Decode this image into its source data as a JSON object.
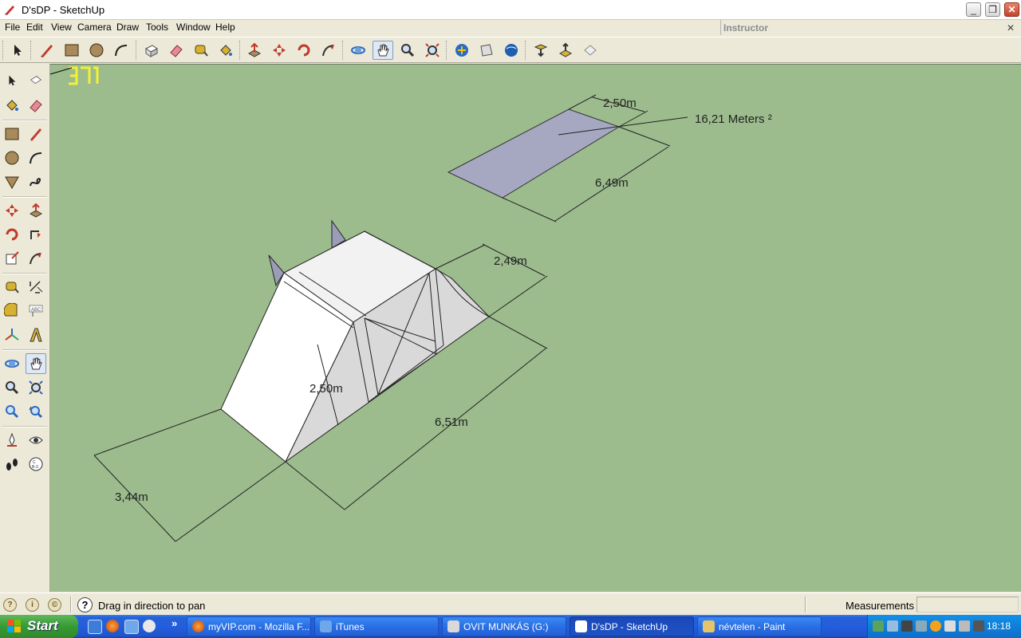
{
  "window": {
    "title": "D'sDP - SketchUp"
  },
  "menubar": {
    "items": [
      "File",
      "Edit",
      "View",
      "Camera",
      "Draw",
      "Tools",
      "Window",
      "Help"
    ]
  },
  "instructor": {
    "label": "Instructor"
  },
  "toolbar": {
    "icons": [
      "select-icon",
      "pencil-icon",
      "rectangle-icon",
      "circle-icon",
      "arc-icon",
      "make-component-icon",
      "eraser-icon",
      "tape-measure-icon",
      "paint-bucket-icon",
      "push-pull-icon",
      "move-icon",
      "rotate-icon",
      "follow-me-icon",
      "orbit-icon",
      "pan-icon",
      "zoom-icon",
      "zoom-extents-icon",
      "get-models-icon",
      "share-model-icon",
      "google-earth-icon",
      "get-current-view-icon",
      "toggle-terrain-icon",
      "place-model-icon"
    ]
  },
  "leftbar": {
    "icons": [
      "select-icon",
      "make-component-icon",
      "paint-bucket-icon",
      "eraser-icon",
      "rectangle-icon",
      "pencil-icon",
      "circle-icon",
      "arc-icon",
      "polygon-icon",
      "freehand-icon",
      "move-icon",
      "push-pull-icon",
      "rotate-icon",
      "follow-me-icon",
      "scale-icon",
      "offset-icon",
      "tape-measure-icon",
      "dimension-icon",
      "protractor-icon",
      "text-icon",
      "axes-icon",
      "3d-text-icon",
      "orbit-icon",
      "pan-icon",
      "zoom-icon",
      "zoom-window-icon",
      "zoom-extents-icon",
      "previous-view-icon",
      "position-camera-icon",
      "look-around-icon",
      "walk-icon",
      "section-plane-icon"
    ]
  },
  "viewport": {
    "counter": "37",
    "dimensions": {
      "top_width": "2,50m",
      "top_area": "16,21 Meters ²",
      "top_length": "6,49m",
      "ramp_width": "2,49m",
      "ramp_height": "2,50m",
      "ramp_length": "6,51m",
      "base_width": "3,44m"
    },
    "colors": {
      "background": "#9cbc8d",
      "plane": "#a5a8c0",
      "solid_top": "#f2f2f2",
      "solid_side": "#d8d8d8"
    }
  },
  "statusbar": {
    "hint": "Drag in direction to pan",
    "measurements_label": "Measurements",
    "measurements_value": ""
  },
  "taskbar": {
    "start": "Start",
    "tasks": [
      "myVIP.com - Mozilla F...",
      "iTunes",
      "OVIT MUNKÁS (G:)",
      "D'sDP - SketchUp",
      "névtelen - Paint"
    ],
    "clock": "18:18"
  }
}
